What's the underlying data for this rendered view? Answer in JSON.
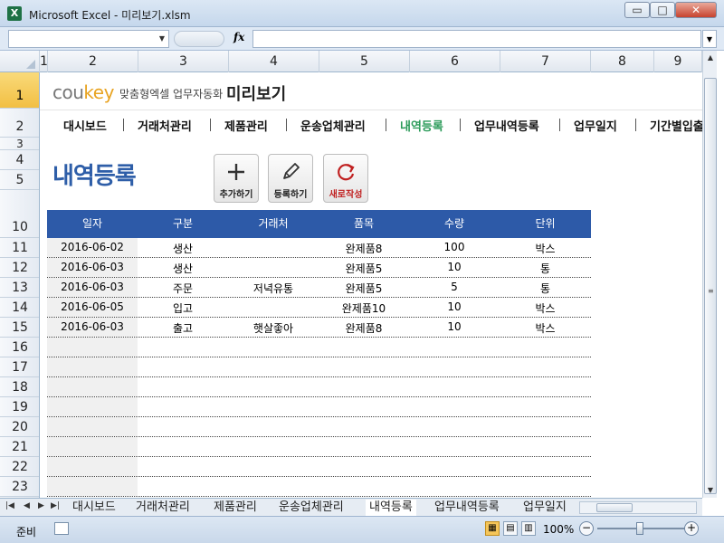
{
  "window": {
    "app_icon": "excel-icon",
    "title": "Microsoft Excel - 미리보기.xlsm",
    "minimize": "▭",
    "maximize": "□",
    "close": "✕"
  },
  "formula_bar": {
    "name_box": "",
    "fx": "fx",
    "value": ""
  },
  "columns": [
    "1",
    "2",
    "3",
    "4",
    "5",
    "6",
    "7",
    "8",
    "9"
  ],
  "rows": [
    "1",
    "2",
    "3",
    "4",
    "5",
    "10",
    "11",
    "12",
    "13",
    "14",
    "15",
    "16",
    "17",
    "18",
    "19",
    "20",
    "21",
    "22",
    "23"
  ],
  "header": {
    "brand_main": "cou",
    "brand_accent": "key",
    "subtitle": "맞춤형엑셀 업무자동화",
    "title": "미리보기"
  },
  "nav": {
    "items": [
      "대시보드",
      "거래처관리",
      "제품관리",
      "운송업체관리",
      "내역등록",
      "업무내역등록",
      "업무일지",
      "기간별입출"
    ],
    "active": "내역등록",
    "active_color": "#2a9a58"
  },
  "page": {
    "title": "내역등록",
    "title_color": "#2e5ea8",
    "buttons": [
      {
        "label": "추가하기",
        "icon": "plus-icon"
      },
      {
        "label": "등록하기",
        "icon": "pencil-icon"
      },
      {
        "label": "새로작성",
        "icon": "refresh-icon"
      }
    ]
  },
  "table": {
    "header_color": "#2d5aa8",
    "columns": [
      "일자",
      "구분",
      "거래처",
      "품목",
      "수량",
      "단위"
    ],
    "rows": [
      [
        "2016-06-02",
        "생산",
        "",
        "완제품8",
        "100",
        "박스"
      ],
      [
        "2016-06-03",
        "생산",
        "",
        "완제품5",
        "10",
        "통"
      ],
      [
        "2016-06-03",
        "주문",
        "저녁유통",
        "완제품5",
        "5",
        "통"
      ],
      [
        "2016-06-05",
        "입고",
        "",
        "완제품10",
        "10",
        "박스"
      ],
      [
        "2016-06-03",
        "출고",
        "햇살좋아",
        "완제품8",
        "10",
        "박스"
      ],
      [
        "",
        "",
        "",
        "",
        "",
        ""
      ],
      [
        "",
        "",
        "",
        "",
        "",
        ""
      ],
      [
        "",
        "",
        "",
        "",
        "",
        ""
      ],
      [
        "",
        "",
        "",
        "",
        "",
        ""
      ],
      [
        "",
        "",
        "",
        "",
        "",
        ""
      ],
      [
        "",
        "",
        "",
        "",
        "",
        ""
      ],
      [
        "",
        "",
        "",
        "",
        "",
        ""
      ],
      [
        "",
        "",
        "",
        "",
        "",
        ""
      ]
    ]
  },
  "sheet_tabs": {
    "items": [
      "대시보드",
      "거래처관리",
      "제품관리",
      "운송업체관리",
      "내역등록",
      "업무내역등록",
      "업무일지"
    ],
    "active": "내역등록"
  },
  "status": {
    "ready": "준비",
    "zoom": "100%",
    "zoom_minus": "−",
    "zoom_plus": "+"
  }
}
